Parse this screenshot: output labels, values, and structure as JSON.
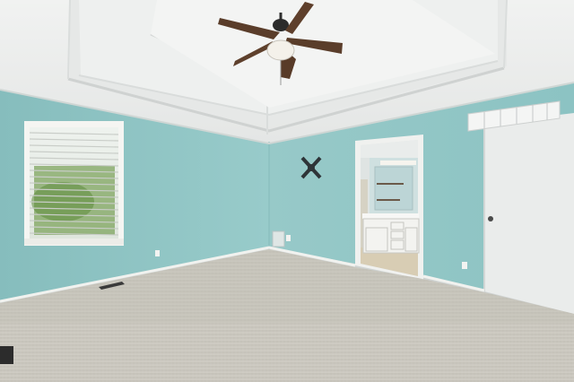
{
  "scene": {
    "kind": "empty-bedroom-photo",
    "colors": {
      "wall": "#8fc4c4",
      "wall_shadow": "#7fb5b6",
      "ceiling": "#eceeed",
      "carpet": "#c9c6bd",
      "trim": "#f2f2ef",
      "door": "#eaeceb",
      "fan_blade": "#5a3d2a"
    },
    "elements": [
      "tray-ceiling",
      "ceiling-fan",
      "window-with-blinds",
      "wall-decor-x",
      "doorway-to-bathroom",
      "bathroom-vanity",
      "closet-door",
      "hvac-return-vent",
      "floor-vents",
      "wall-outlets",
      "carpet-floor"
    ]
  }
}
